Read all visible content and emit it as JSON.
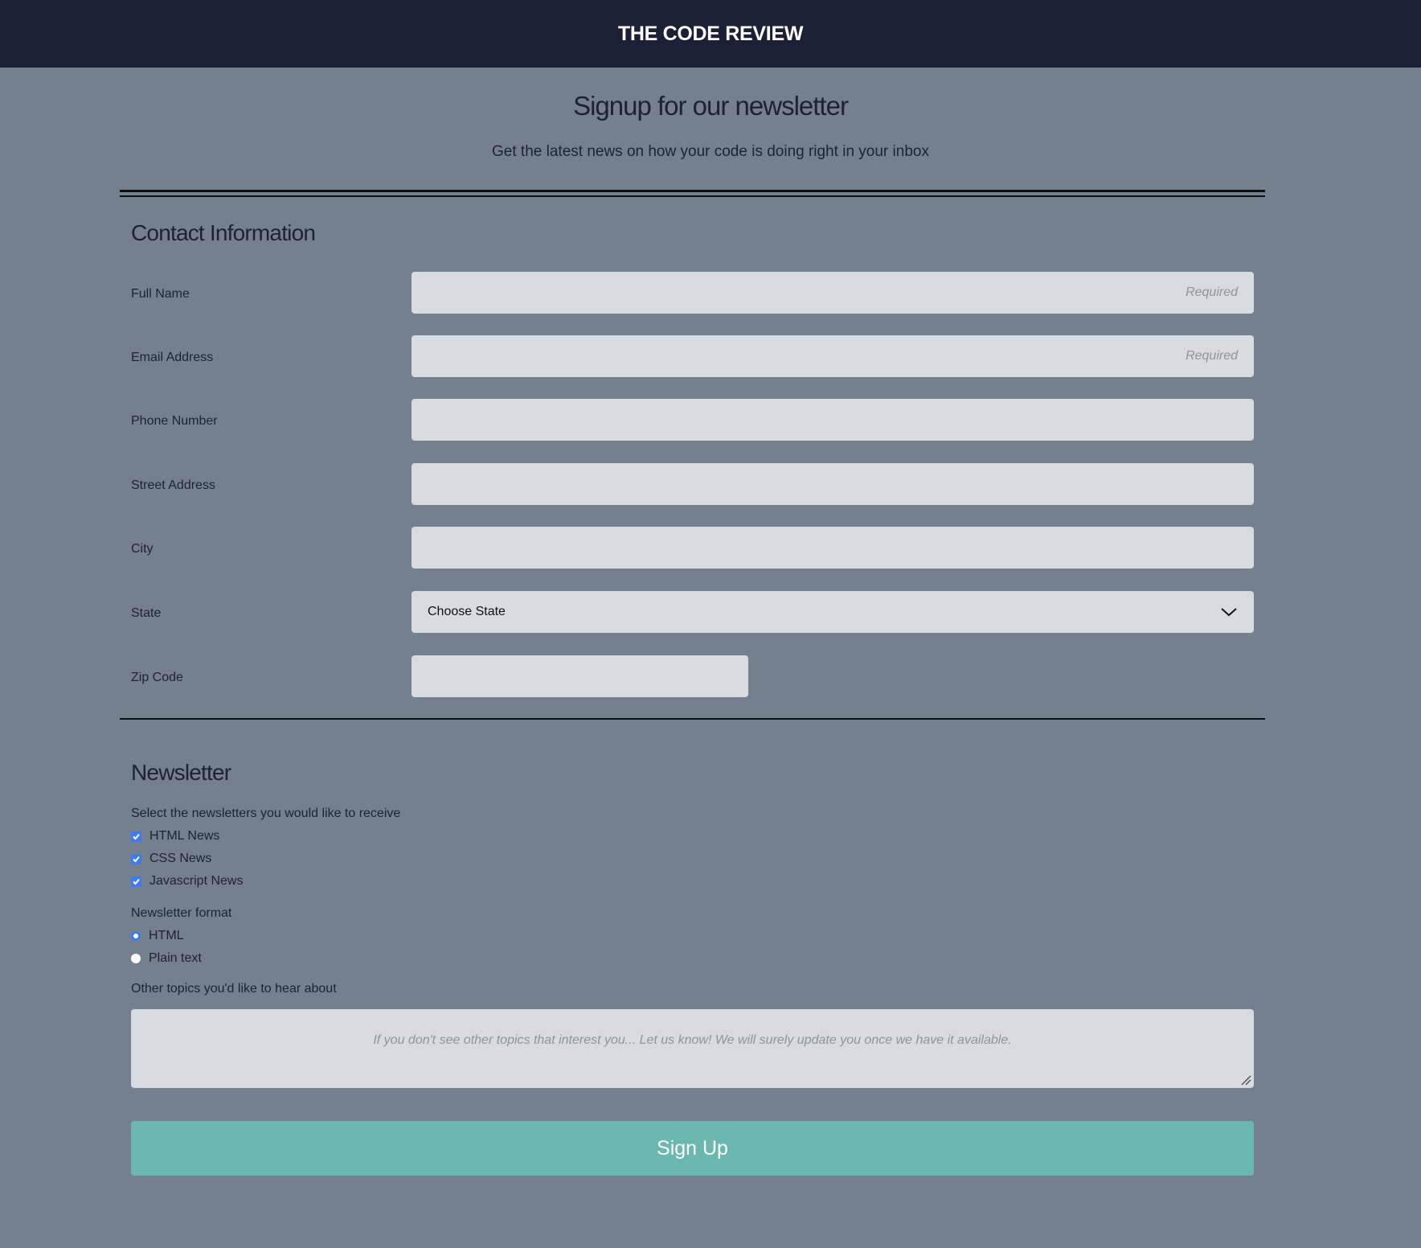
{
  "header": {
    "brand": "THE CODE REVIEW"
  },
  "hero": {
    "title": "Signup for our newsletter",
    "subtitle": "Get the latest news on how your code is doing right in your inbox"
  },
  "contact": {
    "title": "Contact Information",
    "fields": [
      {
        "label": "Full Name",
        "placeholder": "Required",
        "value": ""
      },
      {
        "label": "Email Address",
        "placeholder": "Required",
        "value": ""
      },
      {
        "label": "Phone Number",
        "placeholder": "",
        "value": ""
      },
      {
        "label": "Street Address",
        "placeholder": "",
        "value": ""
      },
      {
        "label": "City",
        "placeholder": "",
        "value": ""
      },
      {
        "label": "State",
        "selected": "Choose State"
      },
      {
        "label": "Zip Code",
        "placeholder": "",
        "value": ""
      }
    ]
  },
  "newsletter": {
    "title": "Newsletter",
    "select_prompt": "Select the newsletters you would like to receive",
    "options": [
      {
        "label": "HTML News",
        "checked": true
      },
      {
        "label": "CSS News",
        "checked": true
      },
      {
        "label": "Javascript News",
        "checked": true
      }
    ],
    "format_label": "Newsletter format",
    "formats": [
      {
        "label": "HTML",
        "selected": true
      },
      {
        "label": "Plain text",
        "selected": false
      }
    ],
    "other_topics_label": "Other topics you'd like to hear about",
    "other_topics_placeholder": "If you don't see other topics that interest you... Let us know! We will surely update you once we have it available."
  },
  "submit": {
    "label": "Sign Up"
  },
  "colors": {
    "background": "#75808f",
    "header": "#1b2035",
    "input": "#d8dce0",
    "button": "#6bb8b0",
    "accent": "#3d7cf0"
  }
}
